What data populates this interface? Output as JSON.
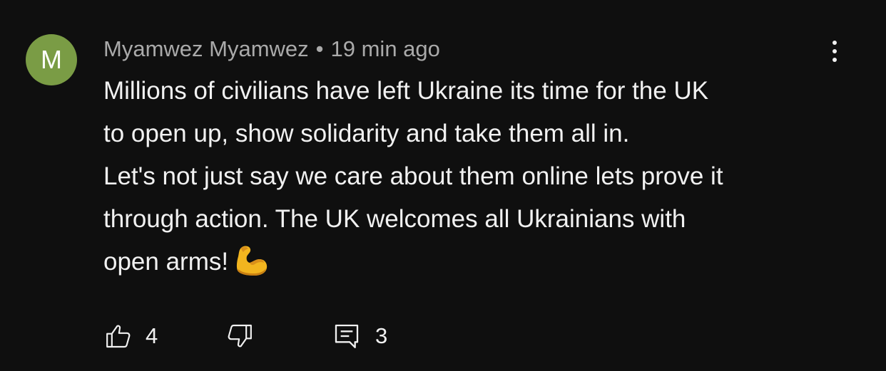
{
  "comment": {
    "avatar_letter": "M",
    "avatar_color": "#7a9c45",
    "author": "Myamwez Myamwez",
    "separator": "•",
    "time": "19 min ago",
    "body_lines": [
      "Millions of civilians have left Ukraine its time for the UK",
      "to open up, show solidarity and take them all in.",
      "Let's not just say we care about them online lets prove it",
      "through action. The UK welcomes all Ukrainians with",
      "open arms!"
    ],
    "trailing_emoji": "flexed-biceps-emoji",
    "menu_icon": "more-vertical-icon",
    "actions": {
      "like_icon": "thumbs-up-icon",
      "like_count": "4",
      "dislike_icon": "thumbs-down-icon",
      "reply_icon": "comment-icon",
      "reply_count": "3"
    }
  }
}
